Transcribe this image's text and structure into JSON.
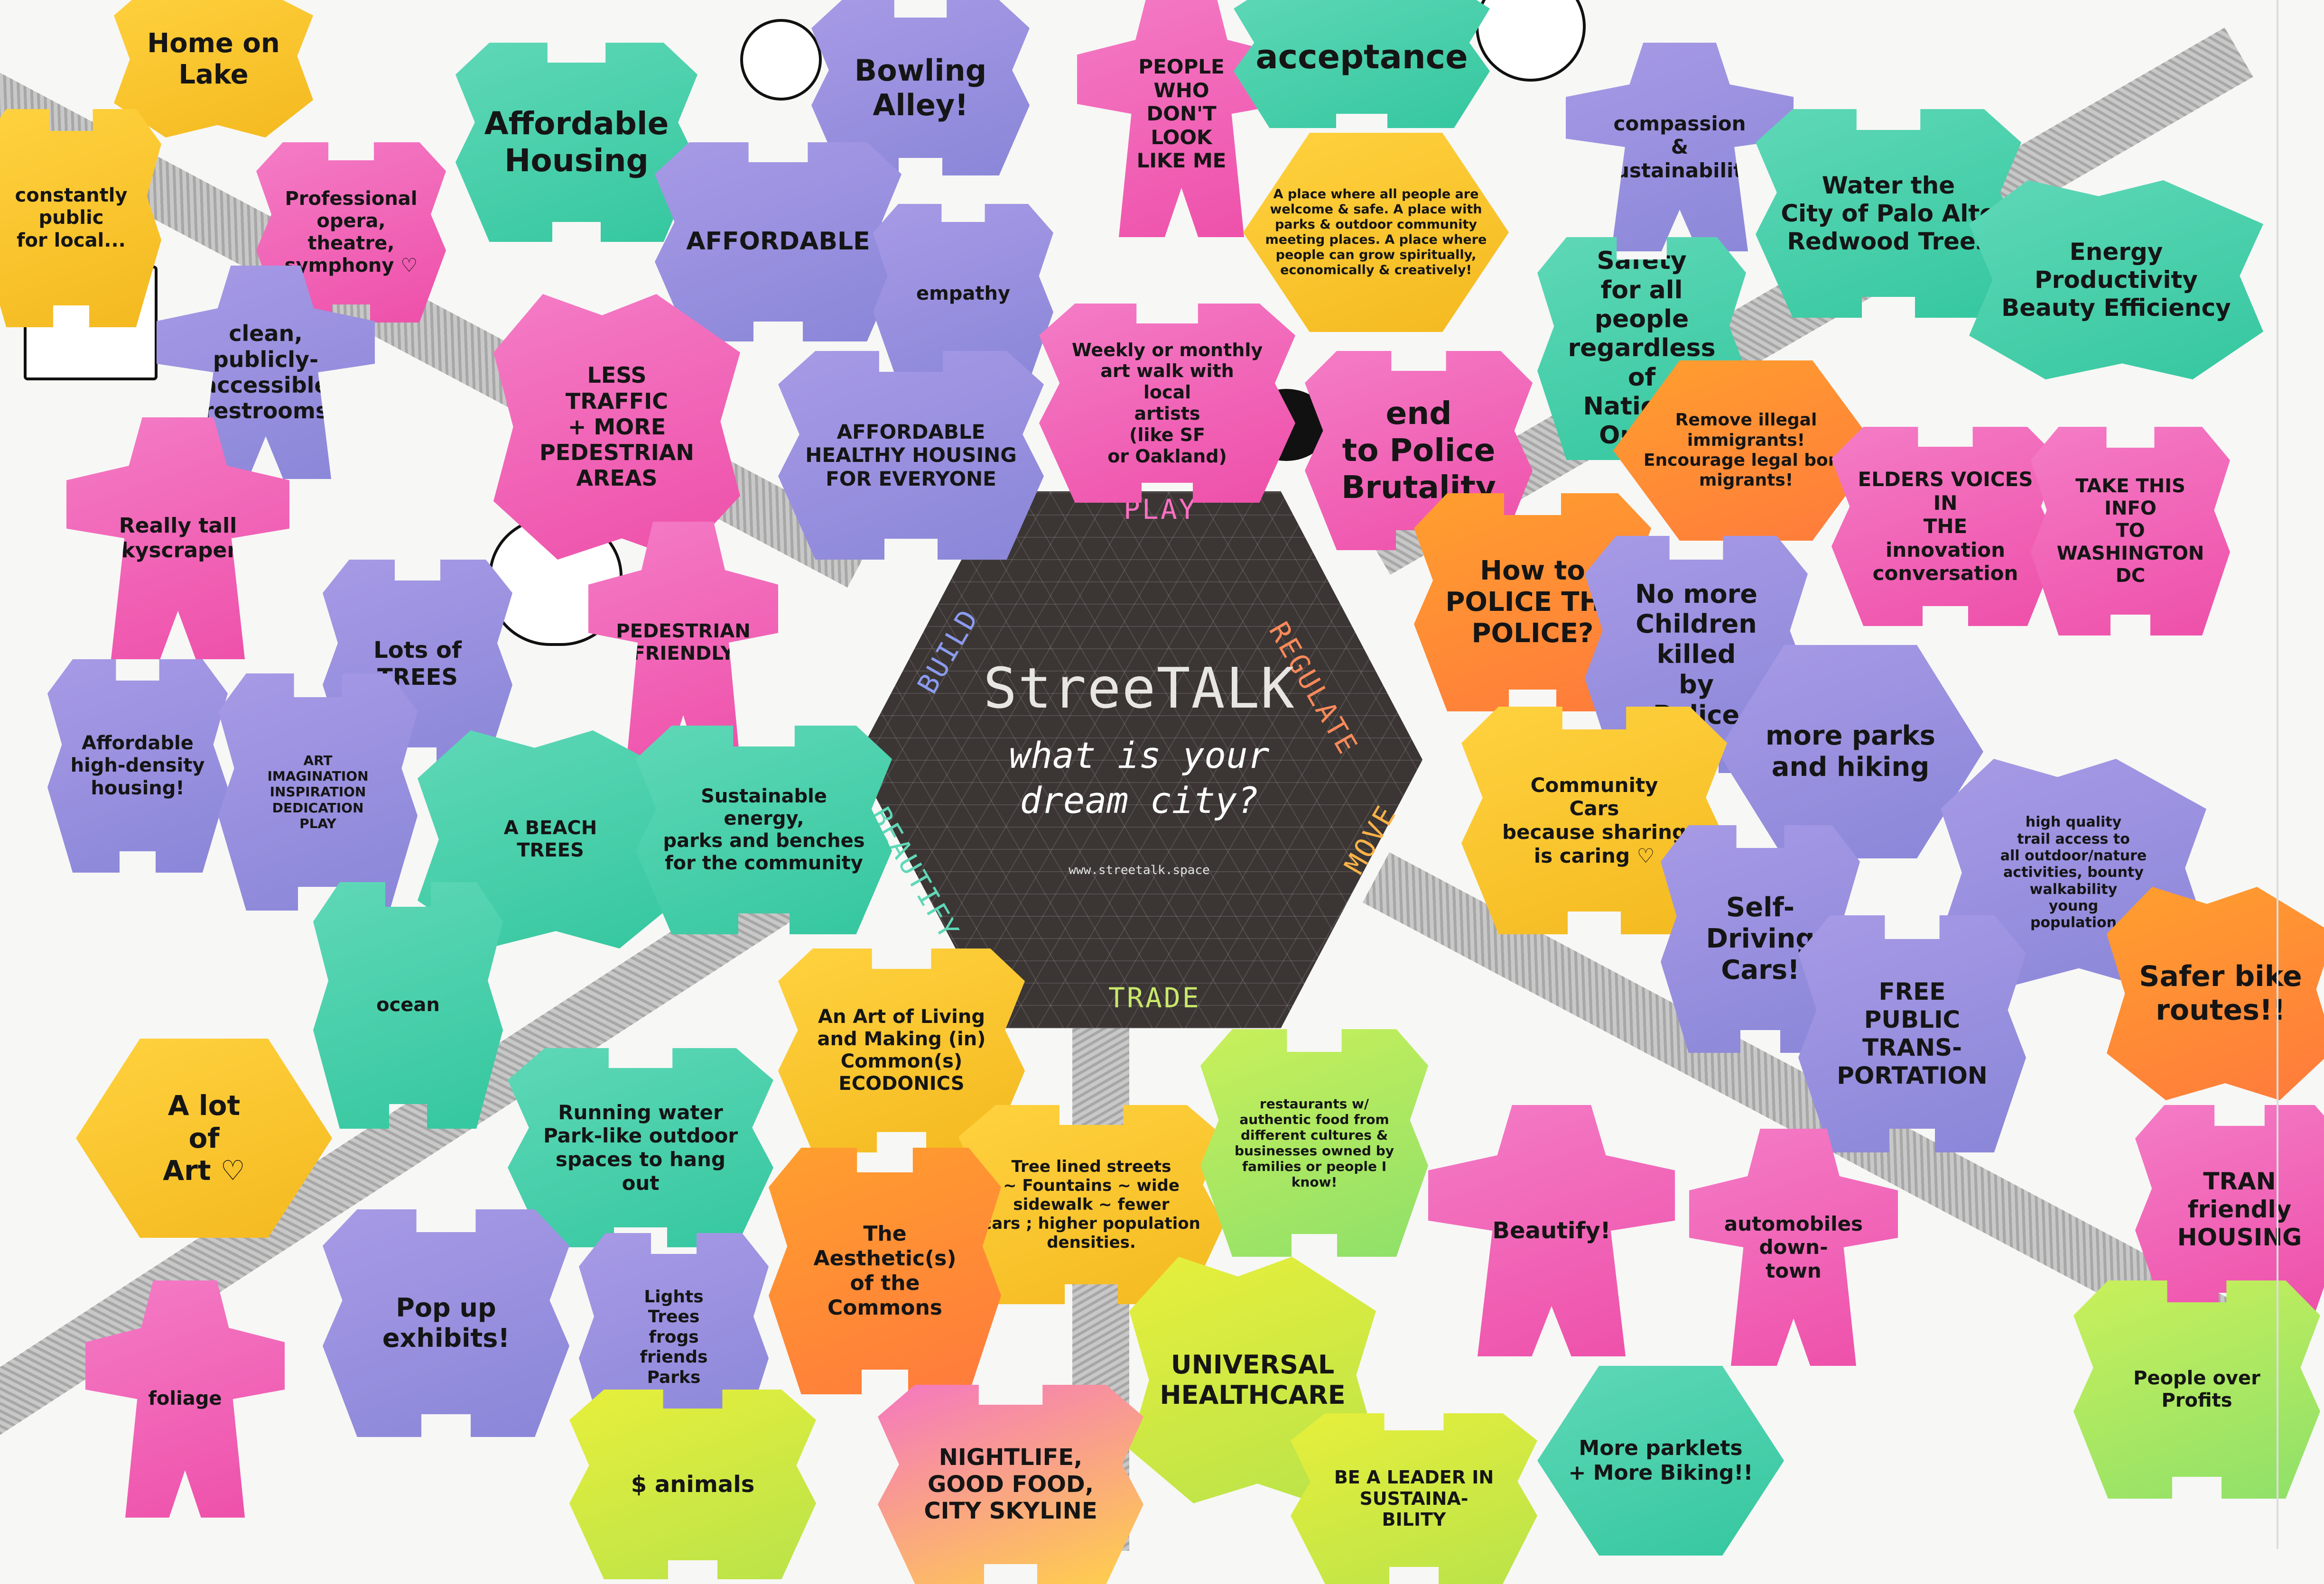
{
  "colors": {
    "pink": "#f47cc6",
    "purple": "#a79ae6",
    "green": "#5fd8b7",
    "yellow": "#ffd23f",
    "orange": "#ff9f2e",
    "hexagon": "#3b3634"
  },
  "center": {
    "title": "StreeTALK",
    "question": "what is your\ndream city?",
    "url": "www.streetalk.space",
    "categories": {
      "play": "PLAY",
      "regulate": "REGULATE",
      "move": "MOVE",
      "trade": "TRADE",
      "beautify": "BEAUTIFY",
      "build": "BUILD"
    },
    "category_colors": {
      "play": "#ff6fc4",
      "regulate": "#ff8a5b",
      "move": "#ffb347",
      "trade": "#c9e86b",
      "beautify": "#5fd8b7",
      "build": "#8b9cf0"
    }
  },
  "notes": [
    {
      "text": "Home on\nLake",
      "color": "yellow"
    },
    {
      "text": "Affordable\nHousing",
      "color": "green"
    },
    {
      "text": "Bowling\nAlley!",
      "color": "purple"
    },
    {
      "text": "PEOPLE\nWHO\nDON'T\nLOOK\nLIKE ME",
      "color": "pink"
    },
    {
      "text": "acceptance",
      "color": "green"
    },
    {
      "text": "compassion\n&\nsustainability",
      "color": "purple"
    },
    {
      "text": "A place where all people are welcome & safe. A place with parks & outdoor community meeting places. A place where people can grow spiritually, economically & creatively!",
      "color": "yellow"
    },
    {
      "text": "Water the\nCity of Palo Alto\nRedwood Trees",
      "color": "green"
    },
    {
      "text": "Energy  Productivity\nBeauty  Efficiency",
      "color": "green"
    },
    {
      "text": "Professional\nopera, theatre,\nsymphony ♡",
      "color": "pink"
    },
    {
      "text": "constantly\npublic\nfor local...",
      "color": "yellow"
    },
    {
      "text": "AFFORDABLE",
      "color": "purple"
    },
    {
      "text": "empathy",
      "color": "purple"
    },
    {
      "text": "Weekly or monthly\nart walk with\nlocal\nartists\n(like SF\nor Oakland)",
      "color": "pink"
    },
    {
      "text": "end\nto Police\nBrutality",
      "color": "pink"
    },
    {
      "text": "Safety\nfor all people\nregardless of\nNational\nOrigin",
      "color": "green"
    },
    {
      "text": "Remove illegal immigrants!\nEncourage legal born\nmigrants!",
      "color": "orange"
    },
    {
      "text": "clean,\npublicly-\naccessible\nrestrooms",
      "color": "purple"
    },
    {
      "text": "LESS\nTRAFFIC\n+ MORE\nPEDESTRIAN\nAREAS",
      "color": "pink"
    },
    {
      "text": "AFFORDABLE\nHEALTHY HOUSING\nFOR EVERYONE",
      "color": "purple"
    },
    {
      "text": "Really tall\nSkyscrapers",
      "color": "pink"
    },
    {
      "text": "Lots of\nTREES",
      "color": "purple"
    },
    {
      "text": "PEDESTRIAN\nFRIENDLY",
      "color": "pink"
    },
    {
      "text": "How to\nPOLICE THE\nPOLICE?",
      "color": "orange"
    },
    {
      "text": "No more\nChildren\nkilled\nby\nPolice",
      "color": "purple"
    },
    {
      "text": "ELDERS VOICES\nIN\nTHE\ninnovation\nconversation",
      "color": "pink"
    },
    {
      "text": "TAKE THIS INFO\nTO WASHINGTON\nDC",
      "color": "pink"
    },
    {
      "text": "Affordable\nhigh-density\nhousing!",
      "color": "purple"
    },
    {
      "text": "ART\nIMAGINATION\nINSPIRATION\nDEDICATION\nPLAY",
      "color": "purple"
    },
    {
      "text": "A BEACH\nTREES",
      "color": "green"
    },
    {
      "text": "Sustainable energy,\nparks and benches\nfor the community",
      "color": "green"
    },
    {
      "text": "more parks\nand hiking",
      "color": "purple"
    },
    {
      "text": "Community\nCars\nbecause sharing\nis caring ♡",
      "color": "yellow"
    },
    {
      "text": "high quality\ntrail access to\nall outdoor/nature\nactivities, bounty\nwalkability\nyoung\npopulation",
      "color": "purple"
    },
    {
      "text": "Self-\nDriving\nCars!",
      "color": "purple"
    },
    {
      "text": "FREE\nPUBLIC\nTRANS-\nPORTATION",
      "color": "purple"
    },
    {
      "text": "Safer bike\nroutes!!",
      "color": "orange"
    },
    {
      "text": "ocean",
      "color": "green"
    },
    {
      "text": "A lot\nof\nArt ♡",
      "color": "yellow"
    },
    {
      "text": "Running water\nPark-like outdoor\nspaces to hang\nout",
      "color": "green"
    },
    {
      "text": "An Art of Living\nand Making (in)\nCommon(s)\nECODONICS",
      "color": "yellow"
    },
    {
      "text": "Tree lined streets\n~ Fountains ~ wide\nsidewalk ~ fewer\ncars ; higher population\ndensities.",
      "color": "yellow"
    },
    {
      "text": "restaurants w/ authentic food from different cultures & businesses owned by families or people I know!",
      "color": "lime"
    },
    {
      "text": "Beautify!",
      "color": "pink"
    },
    {
      "text": "automobiles\ndown-\ntown",
      "color": "pink"
    },
    {
      "text": "TRAN\nfriendly\nHOUSING",
      "color": "pink"
    },
    {
      "text": "The\nAesthetic(s)\nof the\nCommons",
      "color": "orange"
    },
    {
      "text": "Pop up\nexhibits!",
      "color": "purple"
    },
    {
      "text": "Lights\nTrees\nfrogs\nfriends\nParks",
      "color": "purple"
    },
    {
      "text": "UNIVERSAL\nHEALTHCARE",
      "color": "yellowgreen"
    },
    {
      "text": "People over Profits",
      "color": "lime"
    },
    {
      "text": "foliage",
      "color": "pink"
    },
    {
      "text": "$ animals",
      "color": "yellowgreen"
    },
    {
      "text": "NIGHTLIFE,\nGOOD FOOD,\nCITY SKYLINE",
      "color": "pinkyellow"
    },
    {
      "text": "BE A LEADER IN\nSUSTAINA-\nBILITY",
      "color": "yellowgreen"
    },
    {
      "text": "More parklets\n+ More Biking!!",
      "color": "green"
    }
  ]
}
